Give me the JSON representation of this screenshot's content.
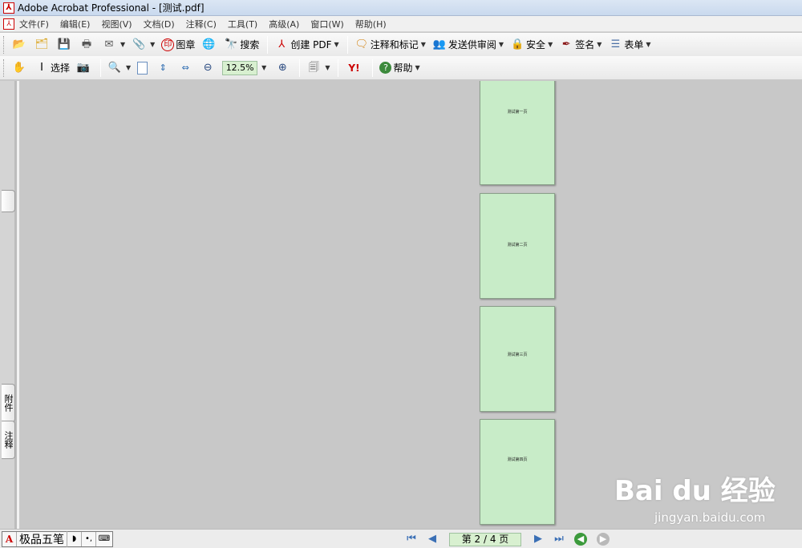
{
  "window": {
    "title": "Adobe Acrobat Professional - [测试.pdf]"
  },
  "menu": [
    "文件(F)",
    "编辑(E)",
    "视图(V)",
    "文档(D)",
    "注释(C)",
    "工具(T)",
    "高级(A)",
    "窗口(W)",
    "帮助(H)"
  ],
  "toolbar1": {
    "stamp_label": "图章",
    "search_label": "搜索",
    "create_pdf_label": "创建 PDF",
    "comment_label": "注释和标记",
    "review_label": "发送供审阅",
    "security_label": "安全",
    "sign_label": "签名",
    "forms_label": "表单"
  },
  "toolbar2": {
    "select_label": "选择",
    "zoom_value": "12.5%",
    "help_label": "帮助"
  },
  "sidebar": {
    "tabs": [
      "附件",
      "注释"
    ]
  },
  "document": {
    "pages": [
      {
        "text": "测试第一页"
      },
      {
        "text": "测试第二页"
      },
      {
        "text": "测试第三页"
      },
      {
        "text": "测试第四页"
      }
    ],
    "page_color": "#c8ecc8"
  },
  "statusbar": {
    "ime_label": "极品五笔",
    "page_indicator": "第 2 / 4 页"
  },
  "watermark": {
    "logo": "Bai du 经验",
    "url": "jingyan.baidu.com"
  }
}
